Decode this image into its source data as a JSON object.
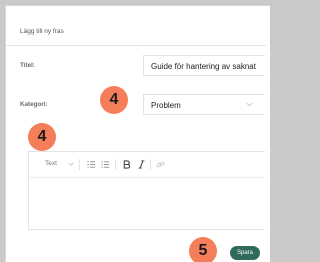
{
  "dialog": {
    "title": "Lägg till ny fras",
    "title_label": "Titel:",
    "title_value": "Guide för hantering av saknat",
    "category_label": "Kategori:",
    "category_value": "Problem",
    "save_label": "Spara"
  },
  "toolbar": {
    "format_label": "Text"
  },
  "badges": {
    "category": "4",
    "editor": "4",
    "save": "5"
  },
  "colors": {
    "badge": "#f47e5a",
    "save_button": "#2f6a5a",
    "background": "#c9c9c9"
  }
}
